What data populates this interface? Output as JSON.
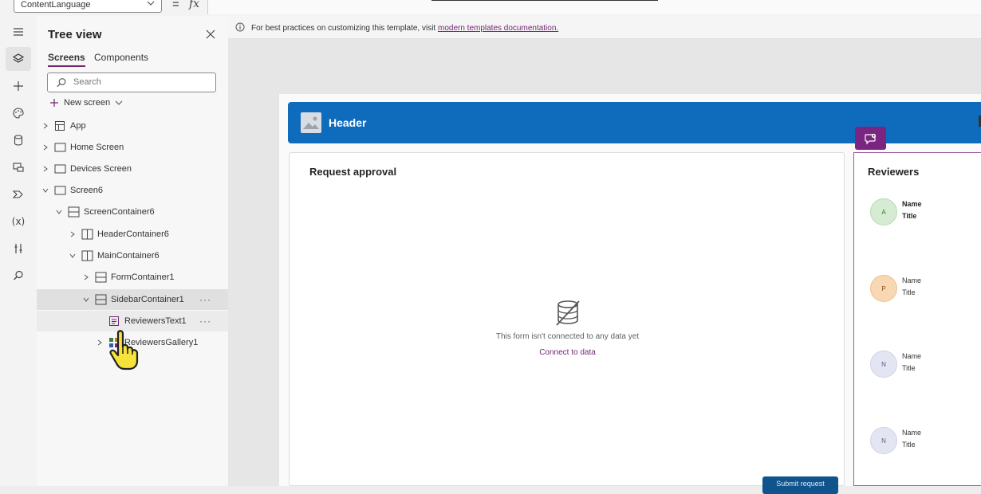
{
  "formula_bar": {
    "property": "ContentLanguage",
    "equals": "=",
    "fx": "fx"
  },
  "tree_view": {
    "title": "Tree view",
    "tabs": [
      {
        "label": "Screens",
        "active": true
      },
      {
        "label": "Components",
        "active": false
      }
    ],
    "search_placeholder": "Search",
    "new_screen_label": "New screen",
    "nodes": [
      {
        "label": "App"
      },
      {
        "label": "Home Screen"
      },
      {
        "label": "Devices Screen"
      },
      {
        "label": "Screen6"
      },
      {
        "label": "ScreenContainer6"
      },
      {
        "label": "HeaderContainer6"
      },
      {
        "label": "MainContainer6"
      },
      {
        "label": "FormContainer1"
      },
      {
        "label": "SidebarContainer1"
      },
      {
        "label": "ReviewersText1"
      },
      {
        "label": "ReviewersGallery1"
      }
    ],
    "more_label": "···"
  },
  "canvas": {
    "info_text": "For best practices on customizing this template, visit",
    "info_link": "modern templates documentation."
  },
  "app": {
    "header_title": "Header",
    "form": {
      "title": "Request approval",
      "empty_message": "This form isn't connected to any data yet",
      "connect_link": "Connect to data",
      "submit_label": "Submit request"
    },
    "sidebar": {
      "title": "Reviewers",
      "reviewers": [
        {
          "initial": "A",
          "name": "Name",
          "title": "Title",
          "color": "#d5ecd3",
          "text_color": "#3f6b3a"
        },
        {
          "initial": "P",
          "name": "Name",
          "title": "Title",
          "color": "#f8d7b3",
          "text_color": "#8a5320"
        },
        {
          "initial": "N",
          "name": "Name",
          "title": "Title",
          "color": "#e3e6f2",
          "text_color": "#5a5f7a"
        },
        {
          "initial": "N",
          "name": "Name",
          "title": "Title",
          "color": "#e3e6f2",
          "text_color": "#5a5f7a"
        }
      ]
    }
  },
  "colors": {
    "header_blue": "#0f6cbd",
    "accent_purple": "#742774",
    "submit_blue": "#0f548c"
  },
  "icons": [
    "menu-icon",
    "layers-icon",
    "plus-icon",
    "palette-icon",
    "database-icon",
    "media-icon",
    "power-automate-icon",
    "variables-icon",
    "tools-icon",
    "search-icon",
    "close-icon",
    "chevron-down-icon",
    "info-icon",
    "image-placeholder-icon",
    "database-off-icon",
    "copilot-icon",
    "hand-cursor-icon"
  ]
}
